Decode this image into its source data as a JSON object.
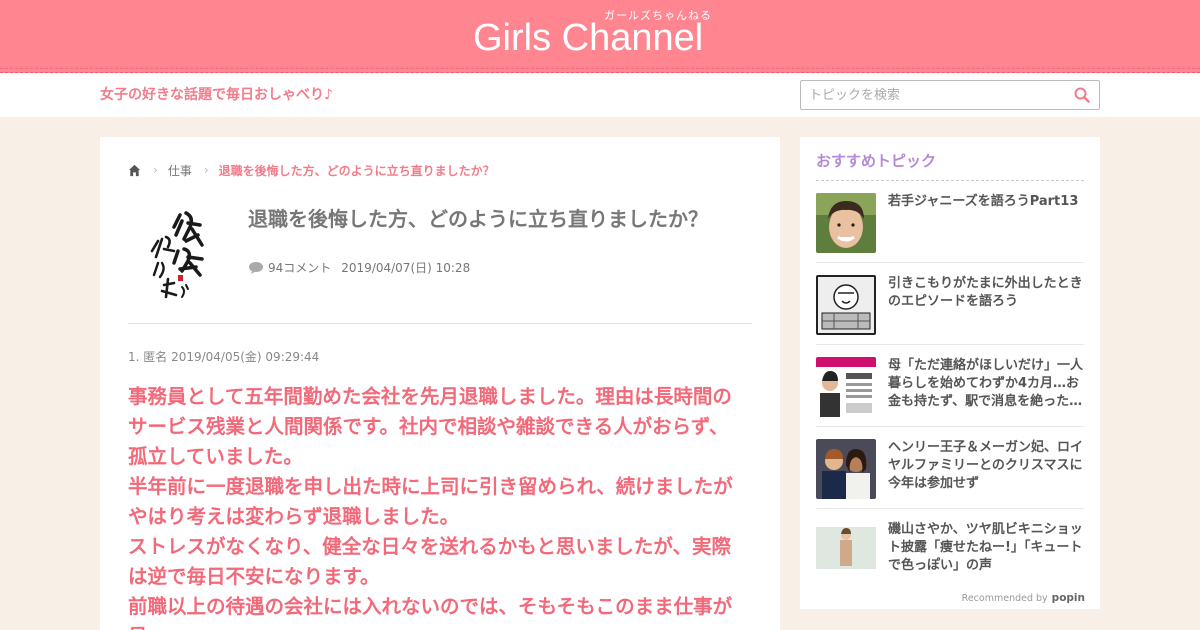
{
  "header": {
    "logo": "Girls Channel",
    "logo_sub": "ガールズちゃんねる"
  },
  "subbar": {
    "tagline": "女子の好きな話題で毎日おしゃべり♪",
    "search_placeholder": "トピックを検索"
  },
  "breadcrumb": {
    "category": "仕事",
    "current": "退職を後悔した方、どのように立ち直りましたか？"
  },
  "topic": {
    "title": "退職を後悔した方、どのように立ち直りましたか？",
    "comments": "94コメント",
    "date": "2019/04/07(日) 10:28"
  },
  "comment": {
    "meta": "1. 匿名 2019/04/05(金) 09:29:44",
    "lines": [
      "事務員として五年間勤めた会社を先月退職しました。理由は長時間の",
      "サービス残業と人間関係です。社内で相談や雑談できる人がおらず、",
      "孤立していました。",
      "半年前に一度退職を申し出た時に上司に引き留められ、続けましたが",
      "やはり考えは変わらず退職しました。",
      "ストレスがなくなり、健全な日々を送れるかもと思いましたが、実際",
      "は逆で毎日不安になります。",
      "前職以上の待遇の会社には入れないのでは、そもそもこのまま仕事が",
      "見"
    ]
  },
  "sidebar": {
    "title": "おすすめトピック",
    "items": [
      {
        "label": "若手ジャニーズを語ろうPart13"
      },
      {
        "label": "引きこもりがたまに外出したときのエピソードを語ろう"
      },
      {
        "label": "母「ただ連絡がほしいだけ」一人暮らしを始めてわずか4カ月…お金も持たず、駅で消息を絶った…"
      },
      {
        "label": "ヘンリー王子＆メーガン妃、ロイヤルファミリーとのクリスマスに今年は参加せず"
      },
      {
        "label": "磯山さやか、ツヤ肌ビキニショット披露「痩せたねー!」「キュートで色っぽい」の声"
      }
    ],
    "recommended": "Recommended by",
    "popin": "popin"
  },
  "colors": {
    "header": "#ff8591",
    "accent": "#f37c8a",
    "comment_text": "#f26a7a",
    "sidebar_title": "#b48ad8",
    "background": "#f8f0e6"
  },
  "icons": [
    "home-icon",
    "chevron-right-icon",
    "search-icon",
    "comment-bubble-icon",
    "popin-logo-icon"
  ]
}
